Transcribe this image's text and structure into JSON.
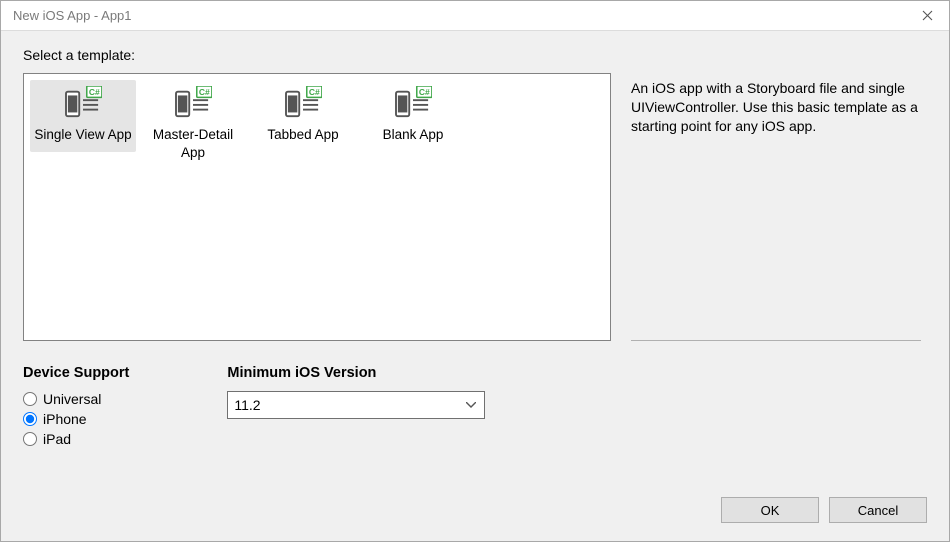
{
  "window": {
    "title": "New iOS App - App1"
  },
  "prompt": "Select a template:",
  "templates": [
    {
      "label": "Single View App",
      "selected": true
    },
    {
      "label": "Master-Detail App",
      "selected": false
    },
    {
      "label": "Tabbed App",
      "selected": false
    },
    {
      "label": "Blank App",
      "selected": false
    }
  ],
  "description": "An iOS app with a Storyboard file and single UIViewController. Use this basic template as a starting point for any iOS app.",
  "optionsHeadings": {
    "device": "Device Support",
    "version": "Minimum iOS Version"
  },
  "deviceSupport": {
    "options": [
      {
        "label": "Universal",
        "checked": false
      },
      {
        "label": "iPhone",
        "checked": true
      },
      {
        "label": "iPad",
        "checked": false
      }
    ]
  },
  "minVersion": {
    "selected": "11.2"
  },
  "buttons": {
    "ok": "OK",
    "cancel": "Cancel"
  }
}
